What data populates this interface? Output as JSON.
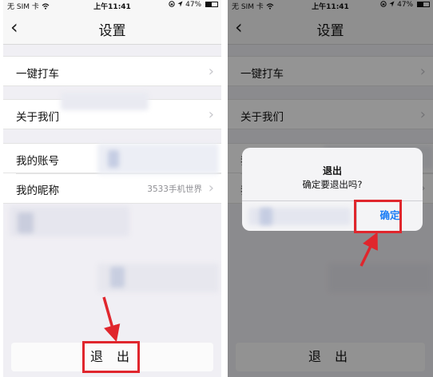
{
  "status_bar": {
    "carrier": "无 SIM 卡",
    "time": "上午11:41",
    "battery": "47%",
    "battery_level": 0.47
  },
  "nav": {
    "title": "设置"
  },
  "left_screen": {
    "rows": [
      {
        "label": "一键打车",
        "value": ""
      },
      {
        "label": "关于我们",
        "value": ""
      },
      {
        "label": "我的账号",
        "value": ""
      },
      {
        "label": "我的昵称",
        "value": "3533手机世界"
      }
    ],
    "logout_label": "退 出"
  },
  "right_screen": {
    "rows": [
      {
        "label": "一键打车"
      },
      {
        "label": "关于我们"
      },
      {
        "label": "我"
      },
      {
        "label": "我"
      }
    ],
    "logout_label": "退 出",
    "dialog": {
      "title": "退出",
      "message": "确定要退出吗?",
      "confirm_label": "确定"
    }
  },
  "colors": {
    "annotation": "#e0262d",
    "ios_blue": "#1a7cf5",
    "background": "#f0eff4"
  },
  "icons": {
    "back": "chevron-left-icon",
    "disclosure": "chevron-right-icon",
    "wifi": "wifi-icon",
    "location": "location-arrow-icon",
    "lock": "orientation-lock-icon",
    "battery": "battery-icon"
  }
}
